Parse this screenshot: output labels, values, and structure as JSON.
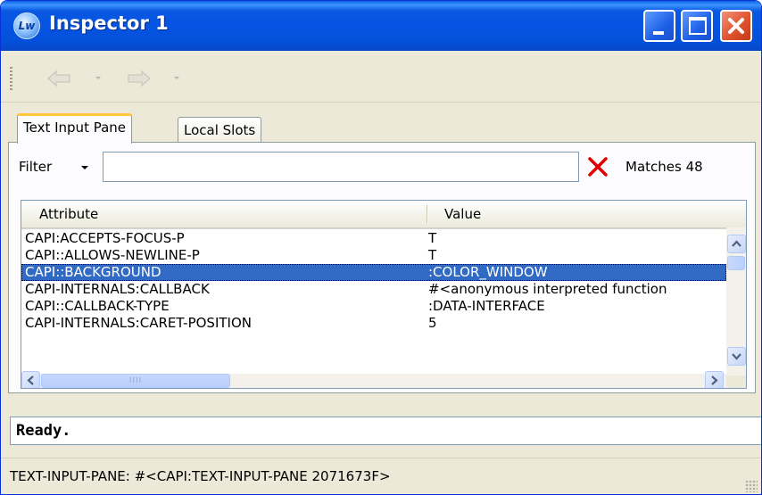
{
  "window": {
    "title": "Inspector 1",
    "icon": "lw-app-icon"
  },
  "toolbar": {
    "back": "back-arrow-icon",
    "forward": "forward-arrow-icon"
  },
  "tabs": [
    {
      "label": "Text Input Pane",
      "active": true
    },
    {
      "label": "Local Slots",
      "active": false
    }
  ],
  "filter": {
    "label": "Filter",
    "value": "",
    "placeholder": "",
    "matches": "Matches 48"
  },
  "table": {
    "columns": [
      "Attribute",
      "Value"
    ],
    "rows": [
      {
        "attribute": "CAPI:ACCEPTS-FOCUS-P",
        "value": "T",
        "selected": false
      },
      {
        "attribute": "CAPI::ALLOWS-NEWLINE-P",
        "value": "T",
        "selected": false
      },
      {
        "attribute": "CAPI::BACKGROUND",
        "value": ":COLOR_WINDOW",
        "selected": true
      },
      {
        "attribute": "CAPI-INTERNALS:CALLBACK",
        "value": "#<anonymous interpreted function",
        "selected": false
      },
      {
        "attribute": "CAPI::CALLBACK-TYPE",
        "value": ":DATA-INTERFACE",
        "selected": false
      },
      {
        "attribute": "CAPI-INTERNALS:CARET-POSITION",
        "value": "5",
        "selected": false
      }
    ]
  },
  "message": "Ready.",
  "status": "TEXT-INPUT-PANE: #<CAPI:TEXT-INPUT-PANE 2071673F>",
  "colors": {
    "titlebar": "#0554e3",
    "selection": "#316ac5",
    "clear": "#e00000"
  }
}
